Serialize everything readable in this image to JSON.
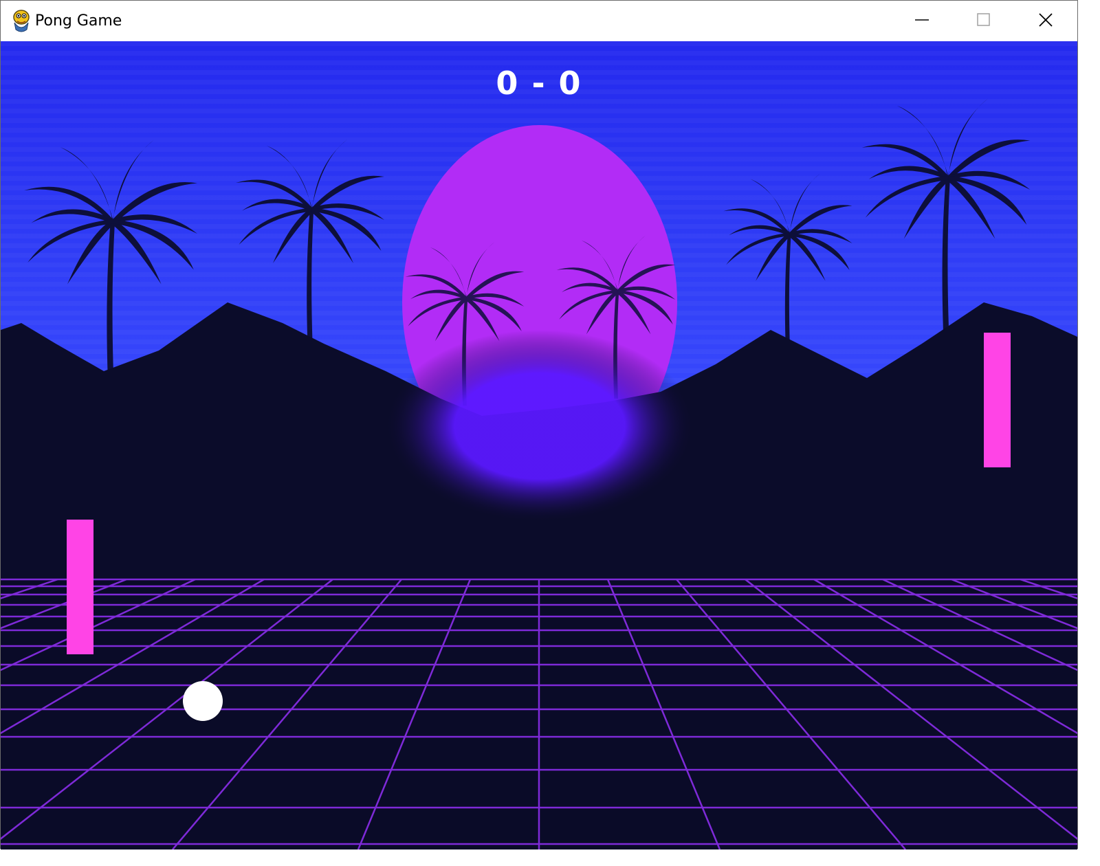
{
  "window": {
    "title": "Pong Game",
    "icon": "python-snake-icon",
    "controls": {
      "minimize_icon": "minimize-icon",
      "maximize_icon": "maximize-icon",
      "close_icon": "close-icon"
    }
  },
  "game": {
    "score": {
      "left": 0,
      "right": 0,
      "display": "0 - 0"
    },
    "colors": {
      "sky_top": "#2a2df0",
      "sky_bottom": "#3a4cff",
      "sun": "#b12cf5",
      "mountains": "#0b0c2a",
      "grid_lines": "#8a2be2",
      "paddle": "#ff44e6",
      "ball": "#ffffff",
      "score_text": "#ffffff"
    },
    "paddles": {
      "left": "left-paddle",
      "right": "right-paddle"
    },
    "ball": "ball"
  }
}
